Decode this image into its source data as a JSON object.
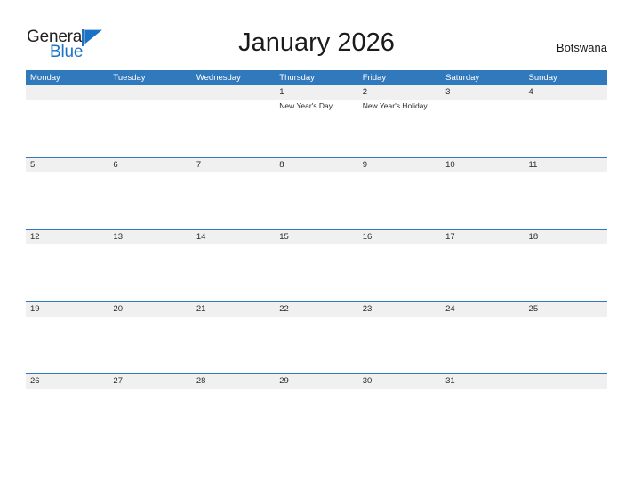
{
  "brand": {
    "name_part1": "General",
    "name_part2": "Blue",
    "mark_icon": "triangle-flag-icon",
    "color_dark": "#231f20",
    "color_blue": "#1a73c4"
  },
  "header": {
    "title": "January 2026",
    "country": "Botswana"
  },
  "theme": {
    "header_blue": "#3179bd",
    "band_gray": "#f0f0f0",
    "text_dark": "#2b2b2b",
    "page_background": "#ffffff"
  },
  "calendar": {
    "month": "January",
    "year": "2026",
    "weekday_headers": [
      "Monday",
      "Tuesday",
      "Wednesday",
      "Thursday",
      "Friday",
      "Saturday",
      "Sunday"
    ],
    "weeks": [
      {
        "days": [
          {
            "number": "",
            "event": ""
          },
          {
            "number": "",
            "event": ""
          },
          {
            "number": "",
            "event": ""
          },
          {
            "number": "1",
            "event": "New Year's Day"
          },
          {
            "number": "2",
            "event": "New Year's Holiday"
          },
          {
            "number": "3",
            "event": ""
          },
          {
            "number": "4",
            "event": ""
          }
        ]
      },
      {
        "days": [
          {
            "number": "5",
            "event": ""
          },
          {
            "number": "6",
            "event": ""
          },
          {
            "number": "7",
            "event": ""
          },
          {
            "number": "8",
            "event": ""
          },
          {
            "number": "9",
            "event": ""
          },
          {
            "number": "10",
            "event": ""
          },
          {
            "number": "11",
            "event": ""
          }
        ]
      },
      {
        "days": [
          {
            "number": "12",
            "event": ""
          },
          {
            "number": "13",
            "event": ""
          },
          {
            "number": "14",
            "event": ""
          },
          {
            "number": "15",
            "event": ""
          },
          {
            "number": "16",
            "event": ""
          },
          {
            "number": "17",
            "event": ""
          },
          {
            "number": "18",
            "event": ""
          }
        ]
      },
      {
        "days": [
          {
            "number": "19",
            "event": ""
          },
          {
            "number": "20",
            "event": ""
          },
          {
            "number": "21",
            "event": ""
          },
          {
            "number": "22",
            "event": ""
          },
          {
            "number": "23",
            "event": ""
          },
          {
            "number": "24",
            "event": ""
          },
          {
            "number": "25",
            "event": ""
          }
        ]
      },
      {
        "days": [
          {
            "number": "26",
            "event": ""
          },
          {
            "number": "27",
            "event": ""
          },
          {
            "number": "28",
            "event": ""
          },
          {
            "number": "29",
            "event": ""
          },
          {
            "number": "30",
            "event": ""
          },
          {
            "number": "31",
            "event": ""
          },
          {
            "number": "",
            "event": ""
          }
        ]
      }
    ]
  }
}
